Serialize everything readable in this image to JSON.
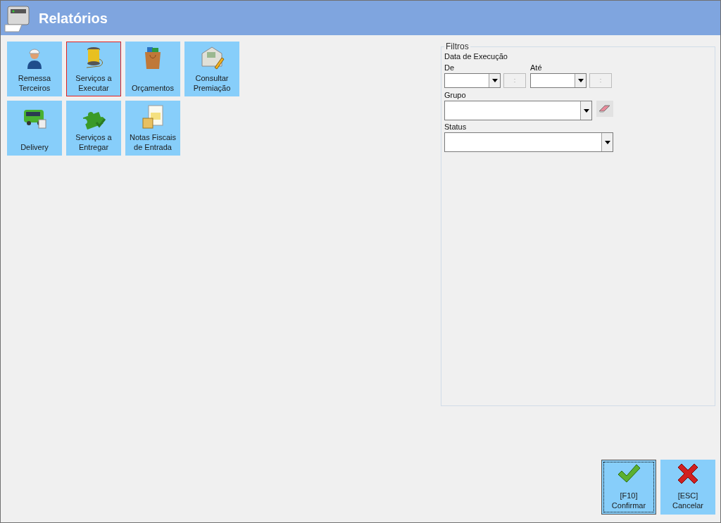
{
  "window": {
    "title": "Relatórios"
  },
  "tiles": [
    {
      "kind": "worker",
      "lines": [
        "Remessa",
        "Terceiros"
      ],
      "selected": false
    },
    {
      "kind": "spool",
      "lines": [
        "Serviços a",
        "Executar"
      ],
      "selected": true
    },
    {
      "kind": "bag",
      "lines": [
        "Orçamentos"
      ],
      "selected": false
    },
    {
      "kind": "envelope",
      "lines": [
        "Consultar",
        "Premiação"
      ],
      "selected": false
    },
    {
      "kind": "bus",
      "lines": [
        "Delivery"
      ],
      "selected": false
    },
    {
      "kind": "puzzle",
      "lines": [
        "Serviços a",
        "Entregar"
      ],
      "selected": false
    },
    {
      "kind": "invoice",
      "lines": [
        "Notas Fiscais",
        "de Entrada"
      ],
      "selected": false
    }
  ],
  "filters": {
    "legend": "Filtros",
    "date_label": "Data de Execução",
    "from": {
      "label": "De",
      "time_separator": ":"
    },
    "to": {
      "label": "Até",
      "time_separator": ":"
    },
    "group": {
      "label": "Grupo"
    },
    "status": {
      "label": "Status"
    }
  },
  "buttons": [
    {
      "kind": "confirm",
      "key": "[F10]",
      "label": "Confirmar",
      "focused": true
    },
    {
      "kind": "cancel",
      "key": "[ESC]",
      "label": "Cancelar",
      "focused": false
    }
  ]
}
